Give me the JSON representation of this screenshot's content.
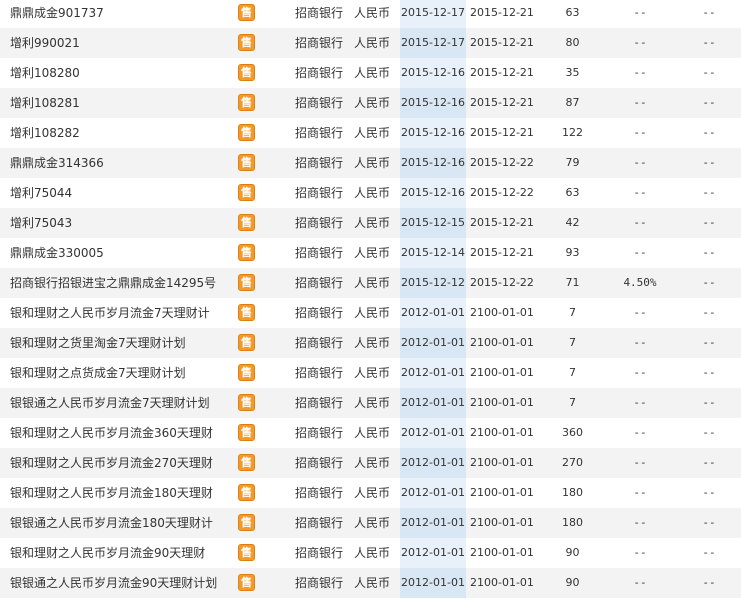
{
  "sell_icon_glyph": "售",
  "colors": {
    "icon": "#f39b2a",
    "highlight_column": "#e8f1fa",
    "alt_row": "#f3f3f3"
  },
  "rows": [
    {
      "name": "鼎鼎成金901737",
      "bank": "招商银行",
      "currency": "人民币",
      "start": "2015-12-17",
      "end": "2015-12-21",
      "days": "63",
      "rate": "--",
      "last": "--"
    },
    {
      "name": "增利990021",
      "bank": "招商银行",
      "currency": "人民币",
      "start": "2015-12-17",
      "end": "2015-12-21",
      "days": "80",
      "rate": "--",
      "last": "--"
    },
    {
      "name": "增利108280",
      "bank": "招商银行",
      "currency": "人民币",
      "start": "2015-12-16",
      "end": "2015-12-21",
      "days": "35",
      "rate": "--",
      "last": "--"
    },
    {
      "name": "增利108281",
      "bank": "招商银行",
      "currency": "人民币",
      "start": "2015-12-16",
      "end": "2015-12-21",
      "days": "87",
      "rate": "--",
      "last": "--"
    },
    {
      "name": "增利108282",
      "bank": "招商银行",
      "currency": "人民币",
      "start": "2015-12-16",
      "end": "2015-12-21",
      "days": "122",
      "rate": "--",
      "last": "--"
    },
    {
      "name": "鼎鼎成金314366",
      "bank": "招商银行",
      "currency": "人民币",
      "start": "2015-12-16",
      "end": "2015-12-22",
      "days": "79",
      "rate": "--",
      "last": "--"
    },
    {
      "name": "增利75044",
      "bank": "招商银行",
      "currency": "人民币",
      "start": "2015-12-16",
      "end": "2015-12-22",
      "days": "63",
      "rate": "--",
      "last": "--"
    },
    {
      "name": "增利75043",
      "bank": "招商银行",
      "currency": "人民币",
      "start": "2015-12-15",
      "end": "2015-12-21",
      "days": "42",
      "rate": "--",
      "last": "--"
    },
    {
      "name": "鼎鼎成金330005",
      "bank": "招商银行",
      "currency": "人民币",
      "start": "2015-12-14",
      "end": "2015-12-21",
      "days": "93",
      "rate": "--",
      "last": "--"
    },
    {
      "name": "招商银行招银进宝之鼎鼎成金14295号",
      "bank": "招商银行",
      "currency": "人民币",
      "start": "2015-12-12",
      "end": "2015-12-22",
      "days": "71",
      "rate": "4.50%",
      "last": "--"
    },
    {
      "name": "银和理财之人民币岁月流金7天理财计",
      "bank": "招商银行",
      "currency": "人民币",
      "start": "2012-01-01",
      "end": "2100-01-01",
      "days": "7",
      "rate": "--",
      "last": "--"
    },
    {
      "name": "银和理财之货里淘金7天理财计划",
      "bank": "招商银行",
      "currency": "人民币",
      "start": "2012-01-01",
      "end": "2100-01-01",
      "days": "7",
      "rate": "--",
      "last": "--"
    },
    {
      "name": "银和理财之点货成金7天理财计划",
      "bank": "招商银行",
      "currency": "人民币",
      "start": "2012-01-01",
      "end": "2100-01-01",
      "days": "7",
      "rate": "--",
      "last": "--"
    },
    {
      "name": "银银通之人民币岁月流金7天理财计划",
      "bank": "招商银行",
      "currency": "人民币",
      "start": "2012-01-01",
      "end": "2100-01-01",
      "days": "7",
      "rate": "--",
      "last": "--"
    },
    {
      "name": "银和理财之人民币岁月流金360天理财",
      "bank": "招商银行",
      "currency": "人民币",
      "start": "2012-01-01",
      "end": "2100-01-01",
      "days": "360",
      "rate": "--",
      "last": "--"
    },
    {
      "name": "银和理财之人民币岁月流金270天理财",
      "bank": "招商银行",
      "currency": "人民币",
      "start": "2012-01-01",
      "end": "2100-01-01",
      "days": "270",
      "rate": "--",
      "last": "--"
    },
    {
      "name": "银和理财之人民币岁月流金180天理财",
      "bank": "招商银行",
      "currency": "人民币",
      "start": "2012-01-01",
      "end": "2100-01-01",
      "days": "180",
      "rate": "--",
      "last": "--"
    },
    {
      "name": "银银通之人民币岁月流金180天理财计",
      "bank": "招商银行",
      "currency": "人民币",
      "start": "2012-01-01",
      "end": "2100-01-01",
      "days": "180",
      "rate": "--",
      "last": "--"
    },
    {
      "name": "银和理财之人民币岁月流金90天理财",
      "bank": "招商银行",
      "currency": "人民币",
      "start": "2012-01-01",
      "end": "2100-01-01",
      "days": "90",
      "rate": "--",
      "last": "--"
    },
    {
      "name": "银银通之人民币岁月流金90天理财计划",
      "bank": "招商银行",
      "currency": "人民币",
      "start": "2012-01-01",
      "end": "2100-01-01",
      "days": "90",
      "rate": "--",
      "last": "--"
    }
  ]
}
